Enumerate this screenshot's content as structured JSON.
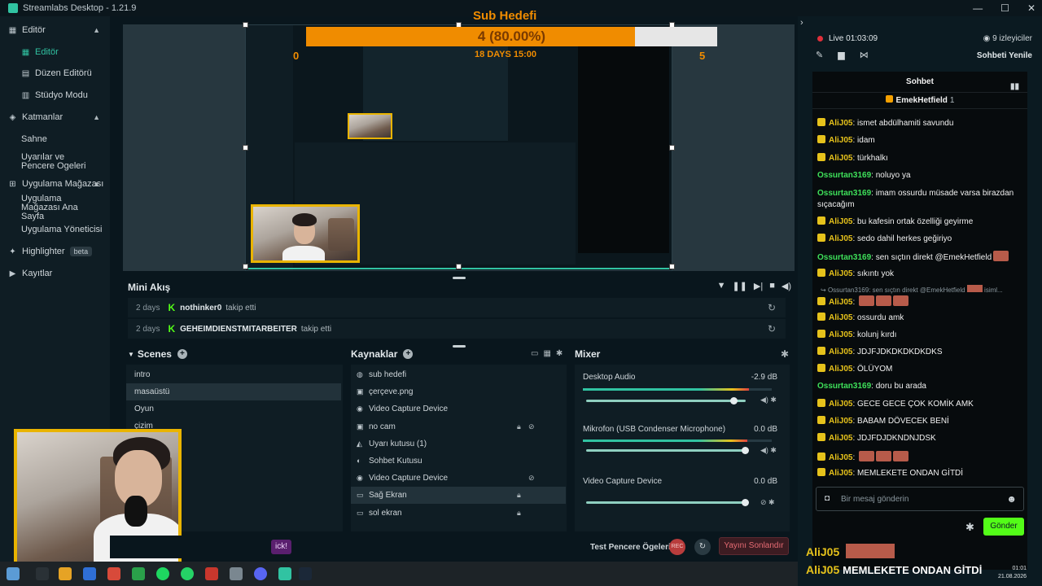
{
  "app": {
    "title": "Streamlabs Desktop - 1.21.9"
  },
  "sidebar": {
    "editor_group": "Editör",
    "items": [
      {
        "label": "Editör"
      },
      {
        "label": "Düzen Editörü"
      },
      {
        "label": "Stüdyo Modu"
      }
    ],
    "layers_group": "Katmanlar",
    "layer_items": [
      {
        "label": "Sahne"
      },
      {
        "label": "Uyarılar ve Pencere Ogeleri"
      }
    ],
    "store_group": "Uygulama Mağazası",
    "store_items": [
      {
        "label": "Uygulama Mağazası Ana Sayfa"
      },
      {
        "label": "Uygulama Yöneticisi"
      }
    ],
    "highlighter": "Highlighter",
    "beta": "beta",
    "recordings": "Kayıtlar"
  },
  "goal": {
    "title": "Sub Hedefi",
    "progress_text": "4 (80.00%)",
    "progress": 0.8,
    "min": "0",
    "max": "5",
    "countdown": "18 DAYS 15:00"
  },
  "mini_feed": {
    "title": "Mini Akış",
    "events": [
      {
        "time": "2 days",
        "user": "nothinker0",
        "action": "takip etti"
      },
      {
        "time": "2 days",
        "user": "GEHEIMDIENSTMITARBEITER",
        "action": "takip etti"
      }
    ]
  },
  "scenes": {
    "title": "Scenes",
    "items": [
      "intro",
      "masaüstü",
      "Oyun",
      "çizim"
    ],
    "selected": 1
  },
  "sources": {
    "title": "Kaynaklar",
    "items": [
      {
        "label": "sub hedefi",
        "icon": "globe-icon"
      },
      {
        "label": "çerçeve.png",
        "icon": "image-icon"
      },
      {
        "label": "Video Capture Device",
        "icon": "camera-icon"
      },
      {
        "label": "no cam",
        "icon": "image-icon"
      },
      {
        "label": "Uyarı kutusu (1)",
        "icon": "alert-icon"
      },
      {
        "label": "Sohbet Kutusu",
        "icon": "chat-icon"
      },
      {
        "label": "Video Capture Device",
        "icon": "camera-icon"
      },
      {
        "label": "Sağ Ekran",
        "icon": "monitor-icon"
      },
      {
        "label": "sol ekran",
        "icon": "monitor-icon"
      }
    ],
    "selected": 7
  },
  "mixer": {
    "title": "Mixer",
    "channels": [
      {
        "name": "Desktop Audio",
        "db": "-2.9 dB",
        "level": 0.88,
        "volume": 0.93
      },
      {
        "name": "Mikrofon (USB Condenser Microphone)",
        "db": "0.0 dB",
        "level": 0.87,
        "volume": 1.0
      },
      {
        "name": "Video Capture Device",
        "db": "0.0 dB",
        "level": 0.0,
        "volume": 1.0
      }
    ]
  },
  "footer": {
    "test_widgets": "Test Pencere Ögeleri",
    "rec": "REC",
    "end_stream": "Yayını Sonlandır",
    "kick_chip": "ick!"
  },
  "chat": {
    "live_label": "Live",
    "live_time": "01:03:09",
    "viewers": "9 izleyiciler",
    "refresh": "Sohbeti Yenile",
    "title": "Sohbet",
    "pinned_user": "EmekHetfield",
    "pinned_count": "1",
    "messages": [
      {
        "user": "AliJ05",
        "text": "ismet abdülhamiti savundu",
        "badge": true
      },
      {
        "user": "AliJ05",
        "text": "idam",
        "badge": true
      },
      {
        "user": "AliJ05",
        "text": "türkhalkı",
        "badge": true
      },
      {
        "user": "Ossurtan3169",
        "text": "noluyo ya",
        "badge": false
      },
      {
        "user": "Ossurtan3169",
        "text": "imam ossurdu müsade varsa birazdan sıçacağım",
        "badge": false
      },
      {
        "user": "AliJ05",
        "text": "bu kafesin ortak özelliği geyirme",
        "badge": true
      },
      {
        "user": "AliJ05",
        "text": "sedo dahil herkes geğiriyo",
        "badge": true
      },
      {
        "user": "Ossurtan3169",
        "text": "sen sıçtın direkt @EmekHetfield",
        "badge": false
      },
      {
        "user": "AliJ05",
        "text": "sıkıntı yok",
        "badge": true
      },
      {
        "user": "AliJ05",
        "text": "",
        "badge": true
      },
      {
        "user": "AliJ05",
        "text": "ossurdu amk",
        "badge": true
      },
      {
        "user": "AliJ05",
        "text": "kolunj kırdı",
        "badge": true
      },
      {
        "user": "AliJ05",
        "text": "JDJFJDKDKDKDKDKS",
        "badge": true
      },
      {
        "user": "AliJ05",
        "text": "ÖLÜYOM",
        "badge": true
      },
      {
        "user": "Ossurtan3169",
        "text": "doru bu arada",
        "badge": false
      },
      {
        "user": "AliJ05",
        "text": "GECE GECE ÇOK KOMİK AMK",
        "badge": true
      },
      {
        "user": "AliJ05",
        "text": "BABAM DÖVECEK BENİ",
        "badge": true
      },
      {
        "user": "AliJ05",
        "text": "JDJFDJDKNDNJDSK",
        "badge": true
      },
      {
        "user": "AliJ05",
        "text": "",
        "badge": true
      },
      {
        "user": "AliJ05",
        "text": "MEMLEKETE ONDAN GİTDİ",
        "badge": true
      }
    ],
    "reply_preview": "Ossurtan3169: sen sıçtın direkt @EmekHetfield",
    "reply_suffix": "isiml...",
    "input_placeholder": "Bir mesaj gönderin",
    "send": "Gönder"
  },
  "overlay_chat": {
    "line1_user": "AliJ05",
    "line2_user": "AliJ05",
    "line2_text": "MEMLEKETE ONDAN GİTDİ"
  },
  "clock": {
    "time": "01:01",
    "date": "21.08.2026"
  }
}
